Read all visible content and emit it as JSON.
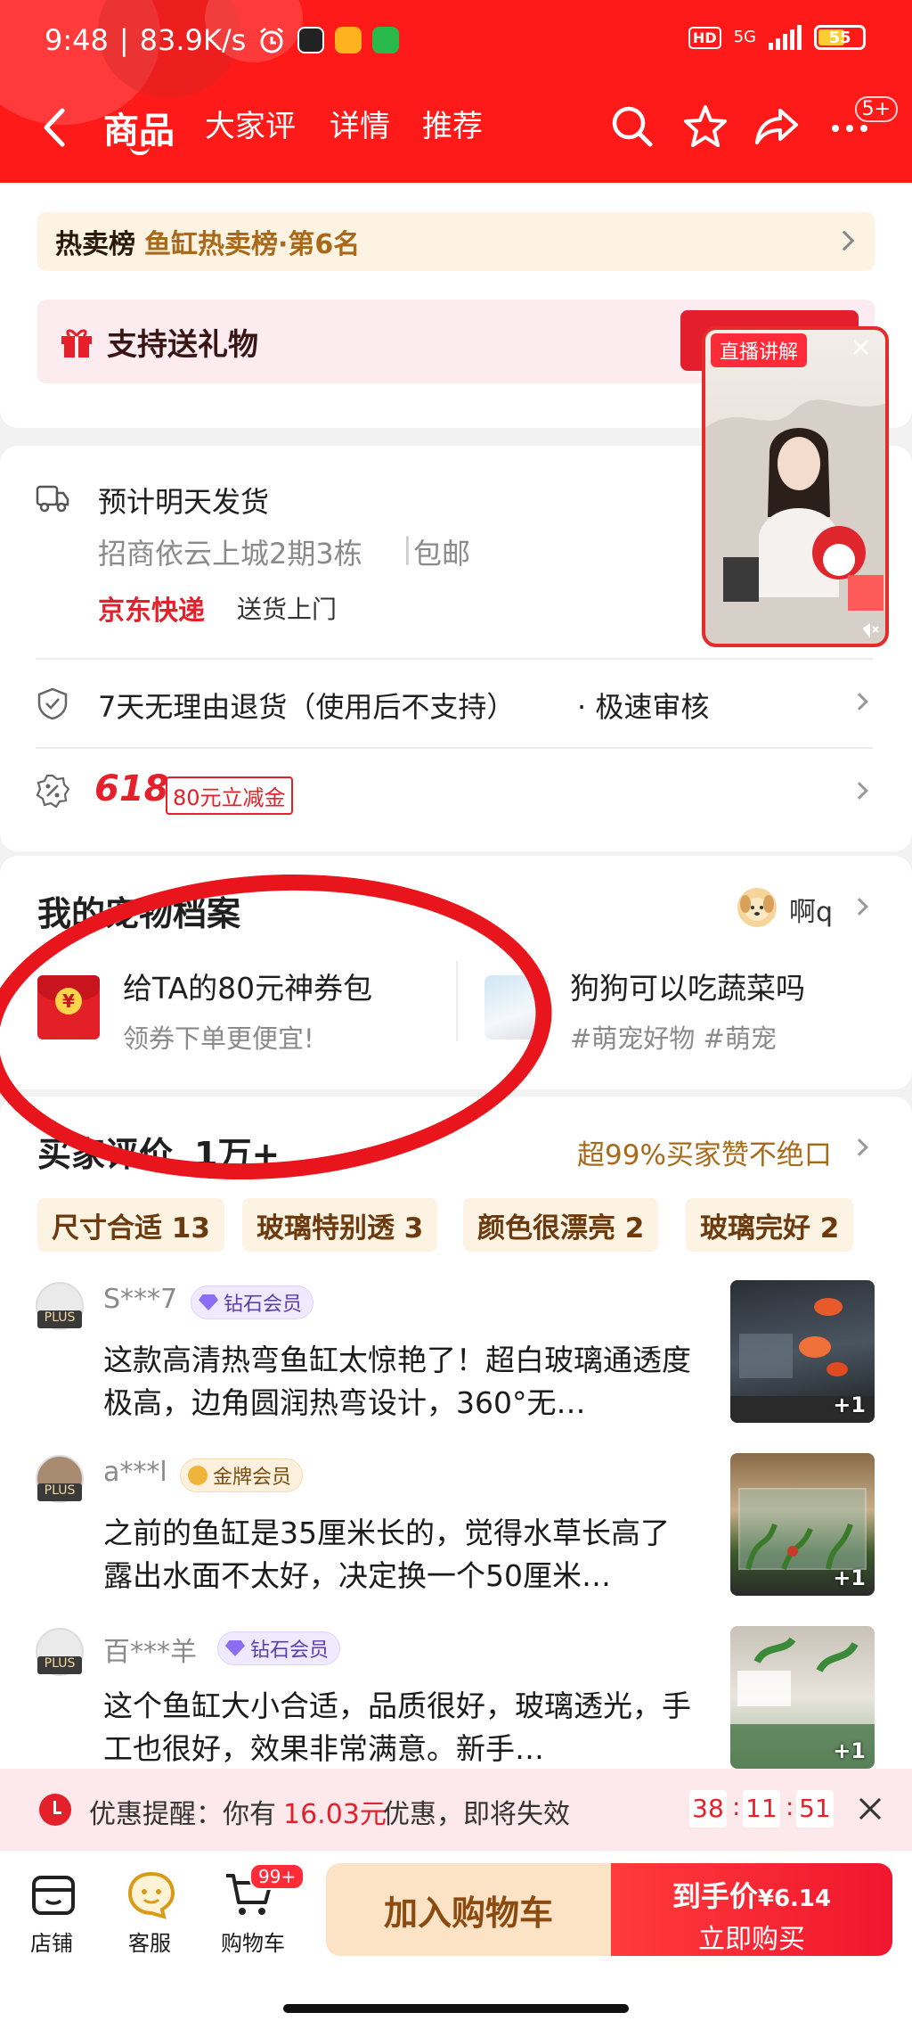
{
  "status_bar": {
    "time": "9:48",
    "net_speed": "83.9K/s",
    "network": "5G",
    "battery": "55"
  },
  "nav": {
    "tabs": [
      "商品",
      "大家评",
      "详情",
      "推荐"
    ],
    "more_badge": "5+"
  },
  "ranking": {
    "label": "热卖榜",
    "value": "鱼缸热卖榜·第6名"
  },
  "gift": {
    "label": "支持送礼物"
  },
  "live_video": {
    "tag": "直播讲解",
    "close": "×"
  },
  "shipping": {
    "title": "预计明天发货",
    "address": "招商依云上城2期3栋",
    "free_shipping": "包邮",
    "courier": "京东快递",
    "delivery": "送货上门"
  },
  "returns": {
    "text": "7天无理由退货（使用后不支持）",
    "extra": "· 极速审核"
  },
  "promo": {
    "event": "618",
    "coupon": "80元立减金"
  },
  "pet_profile": {
    "title": "我的宠物档案",
    "username": "啊q",
    "coupon_title": "给TA的80元神券包",
    "coupon_sub": "领券下单更便宜!",
    "article_title": "狗狗可以吃蔬菜吗",
    "article_tags": "#萌宠好物 #萌宠"
  },
  "reviews": {
    "title": "买家评价",
    "count": "1万+",
    "praise": "超99%买家赞不绝口",
    "chips": [
      "尺寸合适 13",
      "玻璃特别透 3",
      "颜色很漂亮 2",
      "玻璃完好 2"
    ],
    "items": [
      {
        "user": "S***7",
        "level": "钻石会员",
        "badge": "PLUS",
        "text": "这款高清热弯鱼缸太惊艳了！超白玻璃通透度极高，边角圆润热弯设计，360°无…",
        "more": "+1"
      },
      {
        "user": "a***l",
        "level": "金牌会员",
        "badge": "PLUS",
        "text": "之前的鱼缸是35厘米长的，觉得水草长高了露出水面不太好，决定换一个50厘米…",
        "more": "+1"
      },
      {
        "user": "百***羊",
        "level": "钻石会员",
        "badge": "PLUS",
        "text": "这个鱼缸大小合适，品质很好，玻璃透光，手工也很好，效果非常满意。新手…",
        "more": "+1"
      }
    ]
  },
  "reminder": {
    "prefix": "优惠提醒：你有",
    "amount": "16.03元",
    "suffix": "优惠，即将失效",
    "timer": [
      "38",
      "11",
      "51"
    ]
  },
  "bottom_bar": {
    "store": "店铺",
    "service": "客服",
    "cart": "购物车",
    "cart_badge": "99+",
    "add_to_cart": "加入购物车",
    "price_label": "到手价",
    "price": "¥6.14",
    "buy_now": "立即购买"
  },
  "colors": {
    "brand_red": "#ff1a1a",
    "accent_red": "#e4202a",
    "gold_text": "#a86a1a"
  }
}
